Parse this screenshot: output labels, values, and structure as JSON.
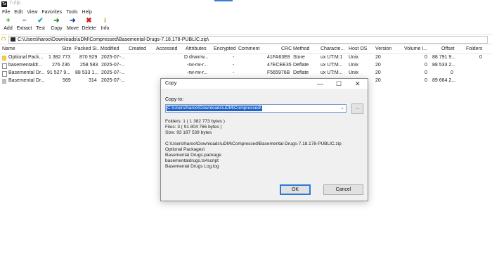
{
  "window": {
    "title": "7-Zip",
    "app_icon": "7z"
  },
  "menu": [
    "File",
    "Edit",
    "View",
    "Favorites",
    "Tools",
    "Help"
  ],
  "toolbar": [
    {
      "label": "Add",
      "icon": "+",
      "color": "#1a9a1a"
    },
    {
      "label": "Extract",
      "icon": "−",
      "color": "#1b4fb8"
    },
    {
      "label": "Test",
      "icon": "✔",
      "color": "#13a0c0"
    },
    {
      "label": "Copy",
      "icon": "➜",
      "color": "#1a8a3a"
    },
    {
      "label": "Move",
      "icon": "➜",
      "color": "#1b3fa8"
    },
    {
      "label": "Delete",
      "icon": "✖",
      "color": "#d02020"
    },
    {
      "label": "Info",
      "icon": "i",
      "color": "#c8a000"
    }
  ],
  "address": {
    "path": "C:\\Users\\haroo\\Downloads\\uDM\\Compressed\\Basemental-Drugs-7.18.178-PUBLIC.zip\\"
  },
  "columns": [
    "Name",
    "Size",
    "Packed Si...",
    "Modified",
    "Created",
    "Accessed",
    "Attributes",
    "Encrypted",
    "Comment",
    "CRC",
    "Method",
    "Characte...",
    "Host OS",
    "Version",
    "Volume I...",
    "Offset",
    "Folders"
  ],
  "files": [
    {
      "icon": "folder",
      "name": "Optional Pack...",
      "size": "1 382 773",
      "packed": "870 929",
      "modified": "2025-07-...",
      "attributes": "D drwxrw...",
      "encrypted": "-",
      "crc": "41FA63E8",
      "method": "Store",
      "characteristics": "ux UT:M:1",
      "host_os": "Unix",
      "version": "20",
      "volume": "0",
      "offset": "88 791 9...",
      "folders": "0"
    },
    {
      "icon": "file",
      "name": "basementaldr...",
      "size": "276 236",
      "packed": "258 583",
      "modified": "2025-07-...",
      "attributes": "-rw-rw-r...",
      "encrypted": "-",
      "crc": "47ECEE35",
      "method": "Deflate",
      "characteristics": "ux UT:M...",
      "host_os": "Unix",
      "version": "20",
      "volume": "0",
      "offset": "88 533 2...",
      "folders": ""
    },
    {
      "icon": "file",
      "name": "Basemental Dr...",
      "size": "91 527 9...",
      "packed": "88 533 1...",
      "modified": "2025-07-...",
      "attributes": "-rw-rw-r...",
      "encrypted": "-",
      "crc": "F565976B",
      "method": "Deflate",
      "characteristics": "ux UT:M...",
      "host_os": "Unix",
      "version": "20",
      "volume": "0",
      "offset": "0",
      "folders": ""
    },
    {
      "icon": "grey",
      "name": "Basemental Dr...",
      "size": "569",
      "packed": "314",
      "modified": "2025-07-...",
      "attributes": "",
      "encrypted": "",
      "crc": "",
      "method": "",
      "characteristics": "",
      "host_os": "",
      "version": "20",
      "volume": "0",
      "offset": "89 664 2...",
      "folders": ""
    }
  ],
  "dialog": {
    "title": "Copy",
    "controls": {
      "minimize": "—",
      "maximize": "☐",
      "close": "✕"
    },
    "copy_to_label": "Copy to:",
    "destination": "C:\\Users\\haroo\\Downloads\\uDM\\Compressed\\",
    "browse_label": "...",
    "info_lines": [
      "Folders: 1    ( 1 382 773 bytes )",
      "Files: 3    ( 91 804 766 bytes )",
      "Size: 93 187 539 bytes",
      "",
      "C:\\Users\\haroo\\Downloads\\uDM\\Compressed\\Basemental-Drugs-7.18.178-PUBLIC.zip",
      "  Optional Packages\\",
      "  Basemental Drugs.package",
      "  basementaldrugs.ts4script",
      "  Basemental Drugs Log.log"
    ],
    "ok_label": "OK",
    "cancel_label": "Cancel"
  }
}
